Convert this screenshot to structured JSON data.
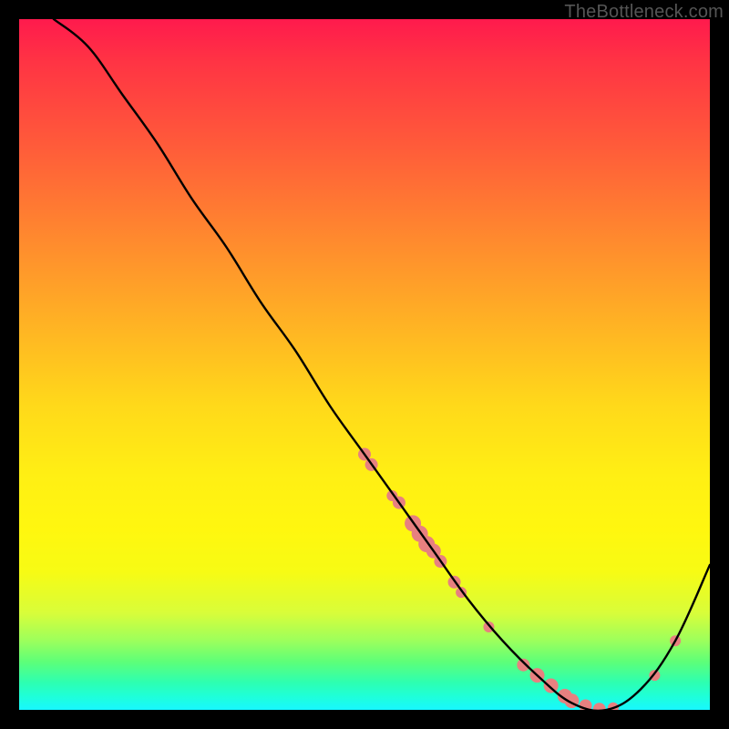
{
  "watermark": "TheBottleneck.com",
  "chart_data": {
    "type": "line",
    "title": "",
    "xlabel": "",
    "ylabel": "",
    "xlim": [
      0,
      100
    ],
    "ylim": [
      0,
      100
    ],
    "grid": false,
    "series": [
      {
        "name": "bottleneck-curve",
        "x": [
          5,
          10,
          15,
          20,
          25,
          30,
          35,
          40,
          45,
          50,
          55,
          60,
          65,
          70,
          75,
          80,
          85,
          90,
          95,
          100
        ],
        "y": [
          100,
          96,
          89,
          82,
          74,
          67,
          59,
          52,
          44,
          37,
          30,
          23,
          16,
          10,
          5,
          1,
          0,
          3,
          10,
          21
        ]
      }
    ],
    "markers": {
      "name": "highlight-points",
      "color": "#e78080",
      "points": [
        {
          "x": 50,
          "y": 37,
          "r": 7
        },
        {
          "x": 51,
          "y": 35.5,
          "r": 7
        },
        {
          "x": 54,
          "y": 31,
          "r": 6
        },
        {
          "x": 55,
          "y": 30,
          "r": 7
        },
        {
          "x": 57,
          "y": 27,
          "r": 9
        },
        {
          "x": 58,
          "y": 25.5,
          "r": 9
        },
        {
          "x": 59,
          "y": 24,
          "r": 9
        },
        {
          "x": 60,
          "y": 23,
          "r": 8
        },
        {
          "x": 61,
          "y": 21.5,
          "r": 7
        },
        {
          "x": 63,
          "y": 18.5,
          "r": 7
        },
        {
          "x": 64,
          "y": 17,
          "r": 6
        },
        {
          "x": 68,
          "y": 12,
          "r": 6
        },
        {
          "x": 73,
          "y": 6.5,
          "r": 7
        },
        {
          "x": 75,
          "y": 5,
          "r": 8
        },
        {
          "x": 77,
          "y": 3.5,
          "r": 8
        },
        {
          "x": 79,
          "y": 2,
          "r": 8
        },
        {
          "x": 80,
          "y": 1.3,
          "r": 8
        },
        {
          "x": 82,
          "y": 0.6,
          "r": 7
        },
        {
          "x": 84,
          "y": 0.1,
          "r": 7
        },
        {
          "x": 86,
          "y": 0.3,
          "r": 6
        },
        {
          "x": 92,
          "y": 5,
          "r": 6
        },
        {
          "x": 95,
          "y": 10,
          "r": 6
        }
      ]
    }
  },
  "colors": {
    "marker": "#e78080",
    "curve": "#000000"
  }
}
